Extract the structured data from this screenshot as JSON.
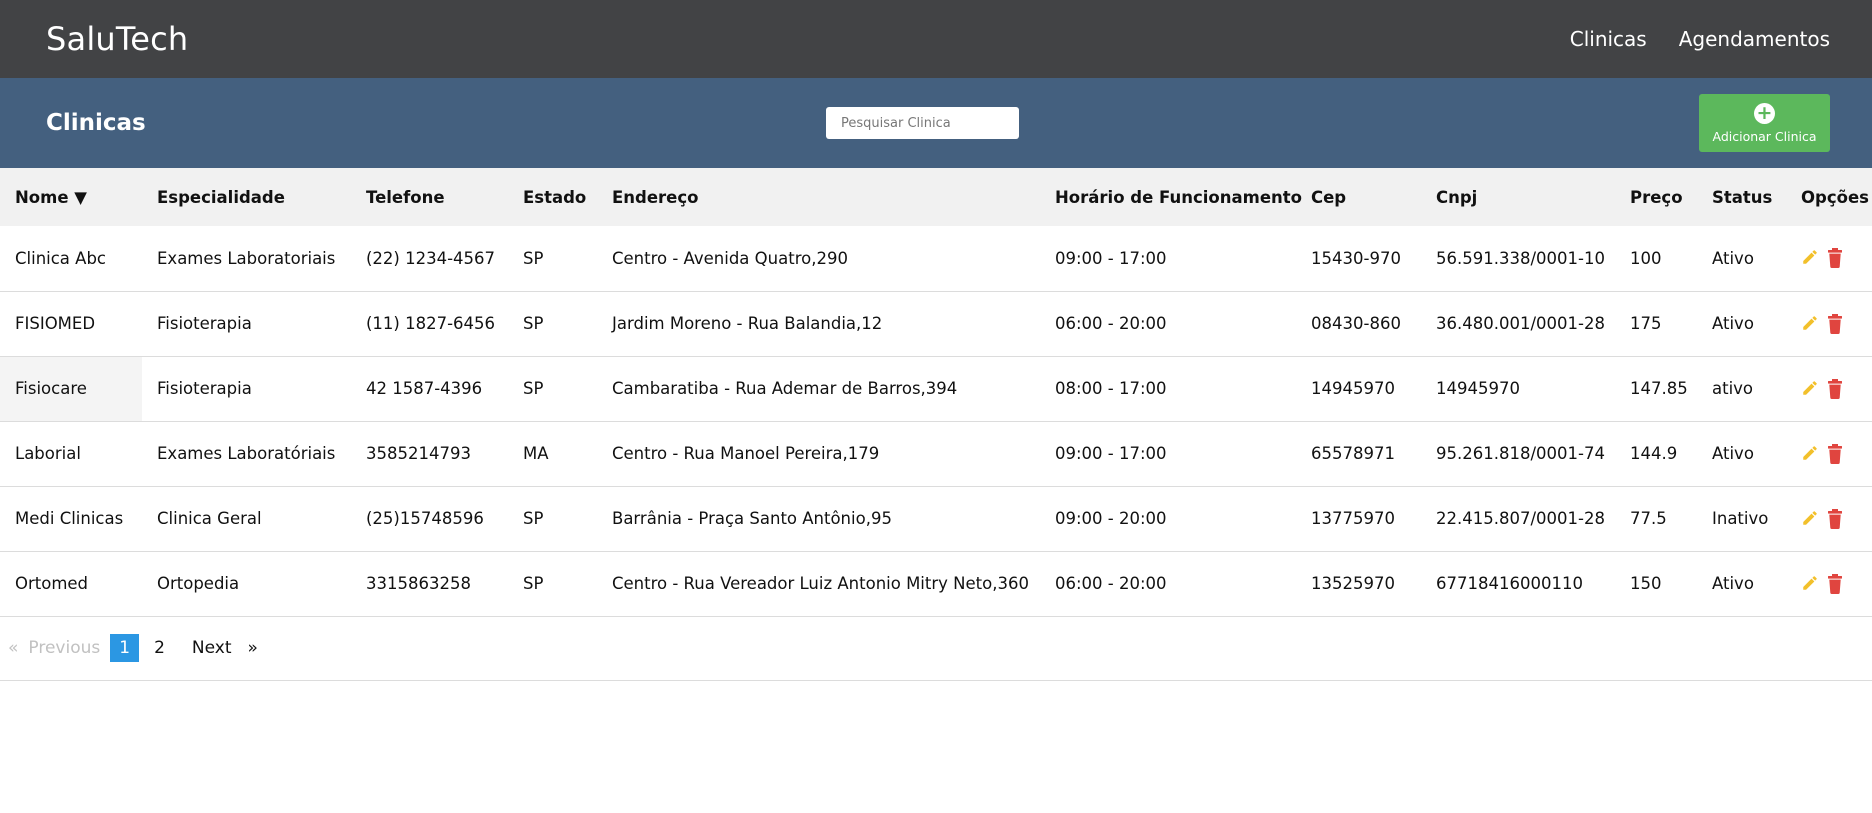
{
  "app": {
    "brand": "SaluTech",
    "nav": [
      "Clinicas",
      "Agendamentos"
    ]
  },
  "header": {
    "title": "Clinicas",
    "search_placeholder": "Pesquisar Clinica",
    "add_button_label": "Adicionar Clinica"
  },
  "table": {
    "columns": [
      "Nome ▼",
      "Especialidade",
      "Telefone",
      "Estado",
      "Endereço",
      "Horário de Funcionamento",
      "Cep",
      "Cnpj",
      "Preço",
      "Status",
      "Opções"
    ],
    "rows": [
      [
        "Clinica Abc",
        "Exames Laboratoriais",
        "(22) 1234-4567",
        "SP",
        "Centro - Avenida Quatro,290",
        "09:00 - 17:00",
        "15430-970",
        "56.591.338/0001-10",
        "100",
        "Ativo"
      ],
      [
        "FISIOMED",
        "Fisioterapia",
        "(11) 1827-6456",
        "SP",
        "Jardim Moreno - Rua Balandia,12",
        "06:00 - 20:00",
        "08430-860",
        "36.480.001/0001-28",
        "175",
        "Ativo"
      ],
      [
        "Fisiocare",
        "Fisioterapia",
        "42 1587-4396",
        "SP",
        "Cambaratiba - Rua Ademar de Barros,394",
        "08:00 - 17:00",
        "14945970",
        "14945970",
        "147.85",
        "ativo"
      ],
      [
        "Laborial",
        "Exames Laboratóriais",
        "3585214793",
        "MA",
        "Centro - Rua Manoel Pereira,179",
        "09:00 - 17:00",
        "65578971",
        "95.261.818/0001-74",
        "144.9",
        "Ativo"
      ],
      [
        "Medi Clinicas",
        "Clinica Geral",
        "(25)15748596",
        "SP",
        "Barrânia - Praça Santo Antônio,95",
        "09:00 - 20:00",
        "13775970",
        "22.415.807/0001-28",
        "77.5",
        "Inativo"
      ],
      [
        "Ortomed",
        "Ortopedia",
        "3315863258",
        "SP",
        "Centro - Rua Vereador Luiz Antonio Mitry Neto,360",
        "06:00 - 20:00",
        "13525970",
        "67718416000110",
        "150",
        "Ativo"
      ]
    ],
    "row_icons": [
      "pencil-icon",
      "trash-icon"
    ]
  },
  "pagination": {
    "prev_arrow": "«",
    "previous": "Previous",
    "pages": [
      "1",
      "2"
    ],
    "current": "1",
    "next": "Next",
    "next_arrow": "»"
  },
  "colors": {
    "topbar": "#424345",
    "header": "#44607f",
    "add_button": "#5cb85c",
    "edit_icon": "#f2c02b",
    "delete_icon": "#e0453f",
    "active_page": "#2b97e3"
  }
}
